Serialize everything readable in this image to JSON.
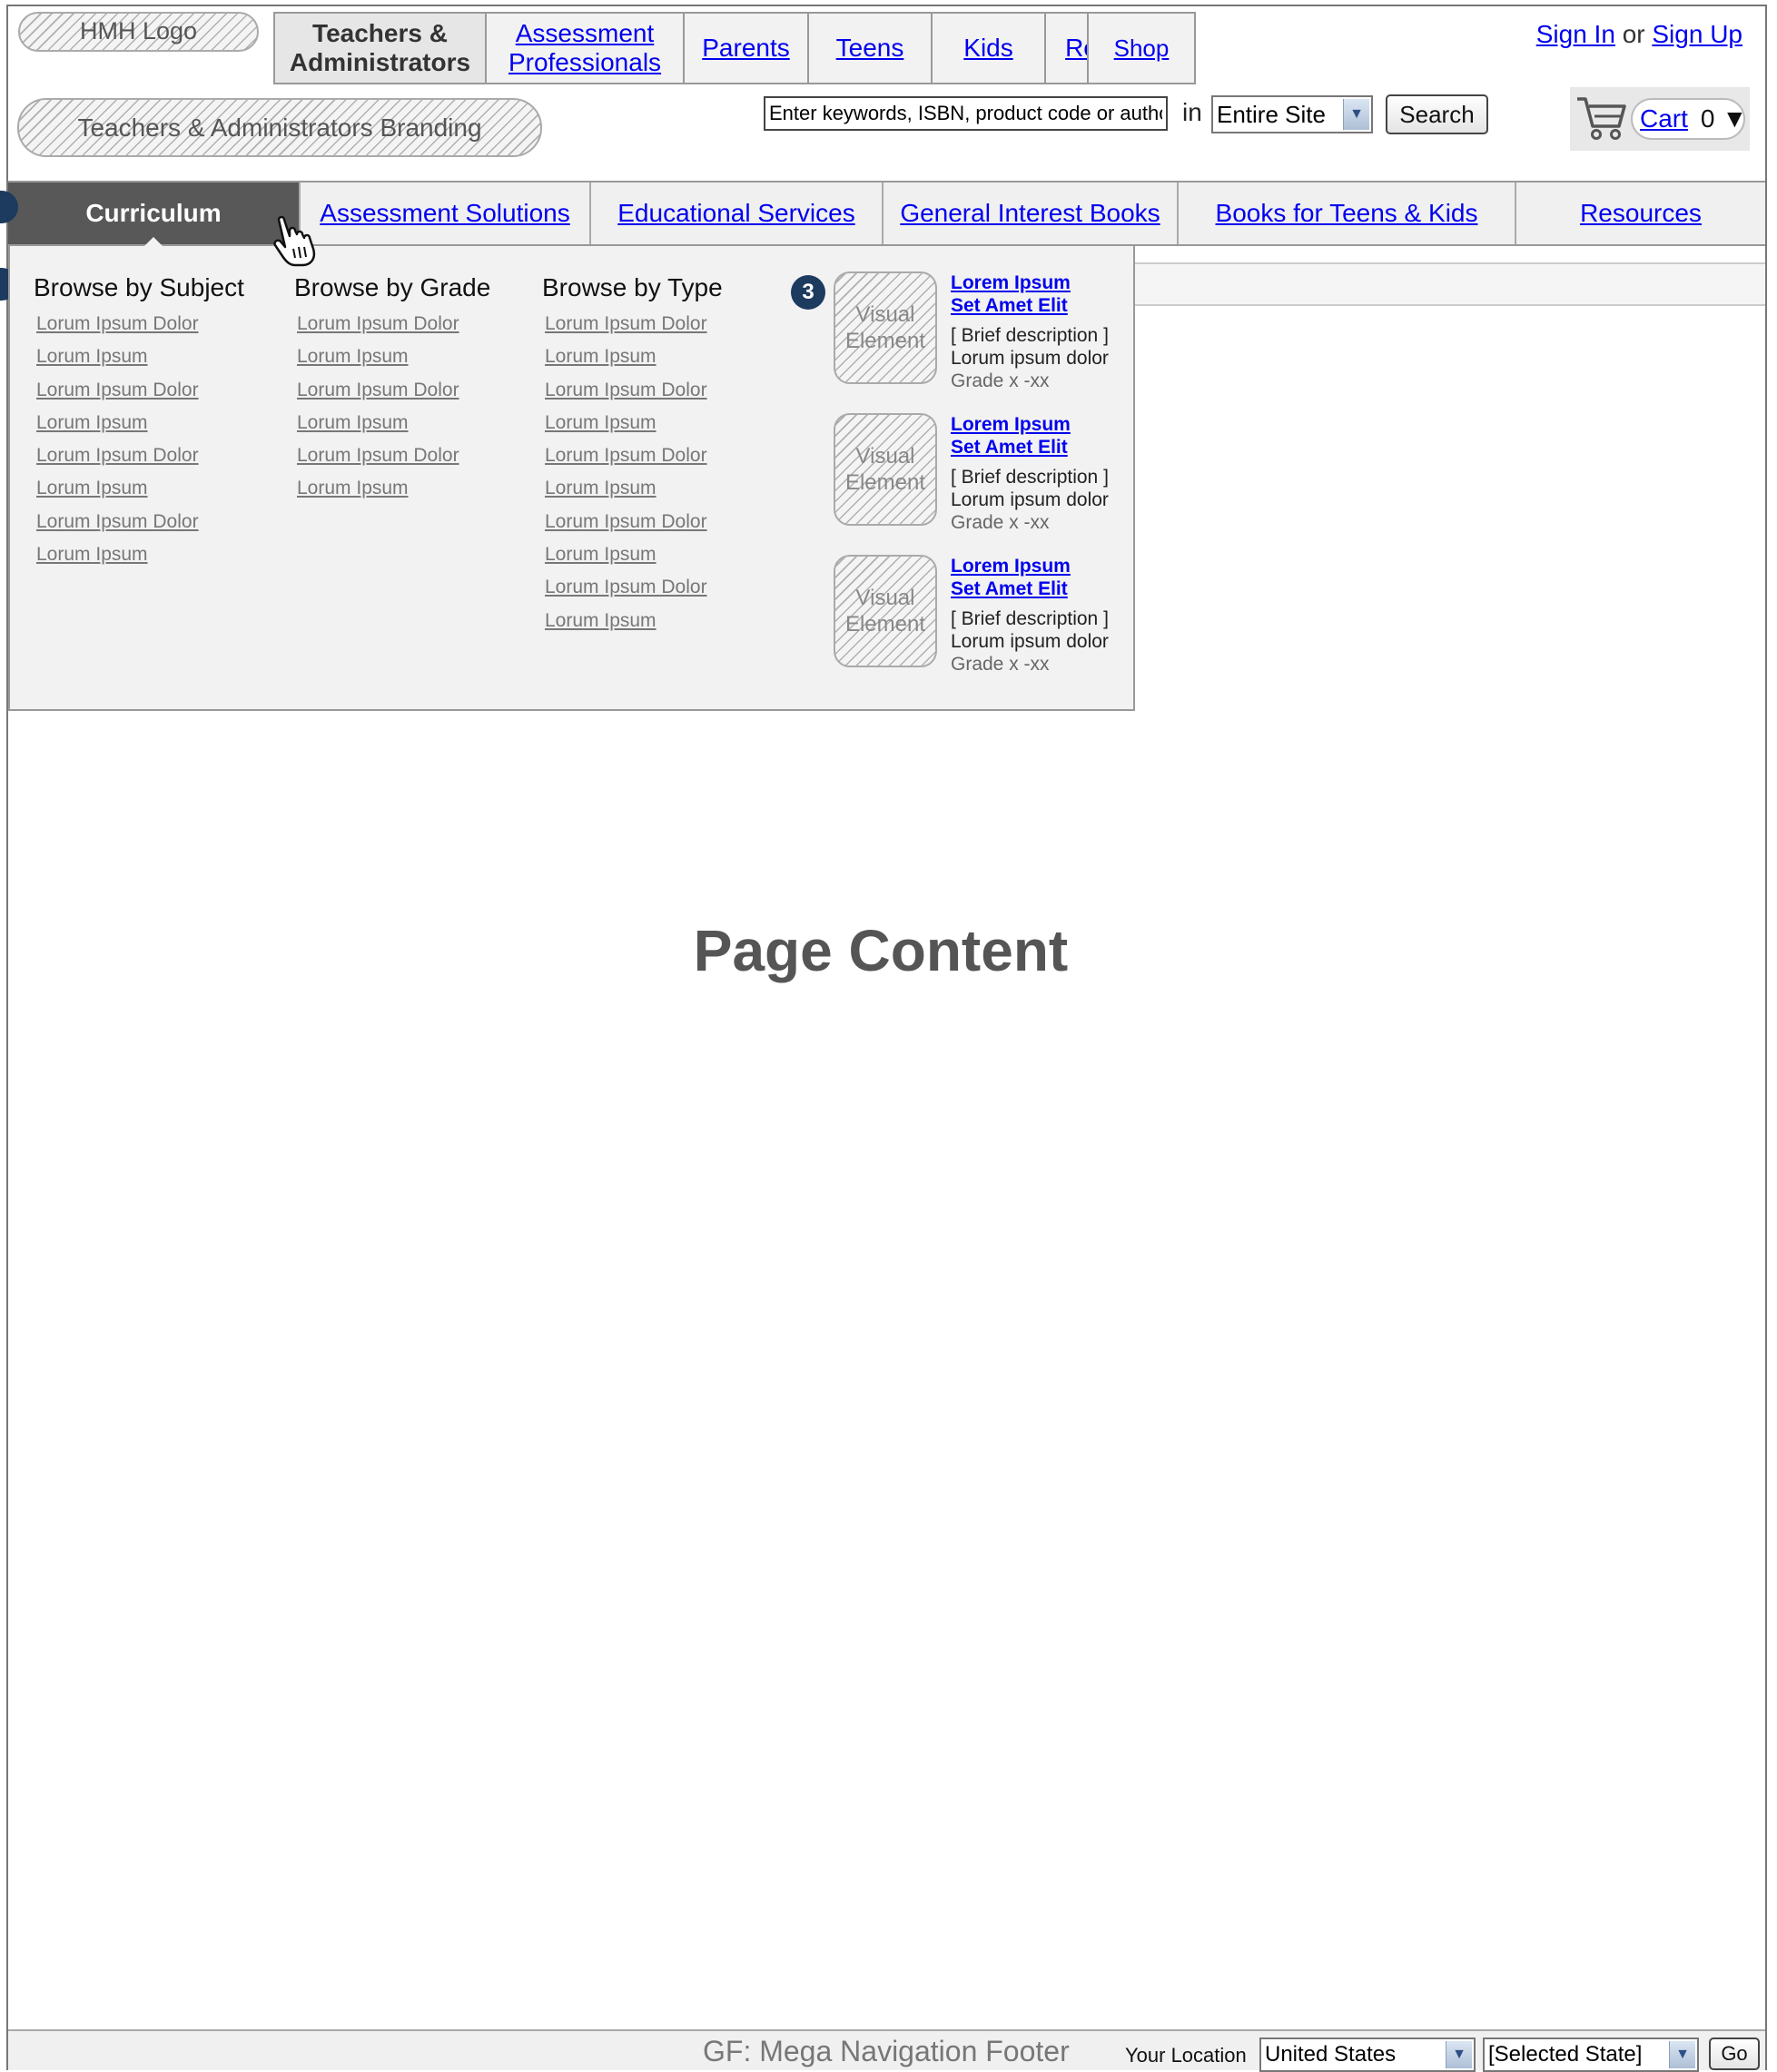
{
  "header": {
    "logo": "HMH Logo",
    "audiences": [
      {
        "label": "Teachers & Administrators",
        "active": true
      },
      {
        "label": "Assessment Professionals"
      },
      {
        "label": "Parents"
      },
      {
        "label": "Teens"
      },
      {
        "label": "Kids"
      },
      {
        "label": "Readers"
      }
    ],
    "shop": "Shop",
    "sign_in": "Sign In",
    "or": "or",
    "sign_up": "Sign Up",
    "branding": "Teachers & Administrators Branding",
    "search": {
      "value": "Enter keywords, ISBN, product code or author",
      "in_label": "in",
      "scope": "Entire Site",
      "button": "Search"
    },
    "cart": {
      "label": "Cart",
      "count": "0",
      "arrow": "▼"
    }
  },
  "main_nav": {
    "tabs": [
      {
        "label": "Curriculum",
        "active": true
      },
      {
        "label": "Assessment Solutions"
      },
      {
        "label": "Educational Services"
      },
      {
        "label": "General Interest Books"
      },
      {
        "label": "Books for Teens & Kids"
      },
      {
        "label": "Resources"
      }
    ]
  },
  "mega_menu": {
    "columns": [
      {
        "heading": "Browse by Subject",
        "items": [
          "Lorum Ipsum Dolor",
          "Lorum Ipsum",
          "Lorum Ipsum Dolor",
          "Lorum Ipsum",
          "Lorum Ipsum Dolor",
          "Lorum Ipsum",
          "Lorum Ipsum Dolor",
          "Lorum Ipsum"
        ]
      },
      {
        "heading": "Browse by Grade",
        "items": [
          "Lorum Ipsum Dolor",
          "Lorum Ipsum",
          "Lorum Ipsum Dolor",
          "Lorum Ipsum",
          "Lorum Ipsum Dolor",
          "Lorum Ipsum"
        ]
      },
      {
        "heading": "Browse by Type",
        "items": [
          "Lorum Ipsum Dolor",
          "Lorum Ipsum",
          "Lorum Ipsum Dolor",
          "Lorum Ipsum",
          "Lorum Ipsum Dolor",
          "Lorum Ipsum",
          "Lorum Ipsum Dolor",
          "Lorum Ipsum",
          "Lorum Ipsum Dolor",
          "Lorum Ipsum"
        ]
      }
    ],
    "featured": [
      {
        "visual": "Visual Element",
        "title_1": "Lorem Ipsum",
        "title_2": "Set Amet Elit",
        "desc_1": "[ Brief description ]",
        "desc_2": "Lorum ipsum dolor",
        "grade": "Grade x -xx"
      },
      {
        "visual": "Visual Element",
        "title_1": "Lorem Ipsum",
        "title_2": "Set Amet Elit",
        "desc_1": "[ Brief description ]",
        "desc_2": "Lorum ipsum dolor",
        "grade": "Grade x -xx"
      },
      {
        "visual": "Visual Element",
        "title_1": "Lorem Ipsum",
        "title_2": "Set Amet Elit",
        "desc_1": "[ Brief description ]",
        "desc_2": "Lorum ipsum dolor",
        "grade": "Grade x -xx"
      }
    ],
    "annotation_badge": "3"
  },
  "page_content": "Page Content",
  "footer": {
    "title": "GF: Mega Navigation Footer",
    "location_label": "Your Location",
    "country": "United States",
    "state": "[Selected State]",
    "go": "Go"
  },
  "icons": [
    "cart-icon",
    "pointer-hand-icon",
    "dropdown-arrow-icon"
  ]
}
